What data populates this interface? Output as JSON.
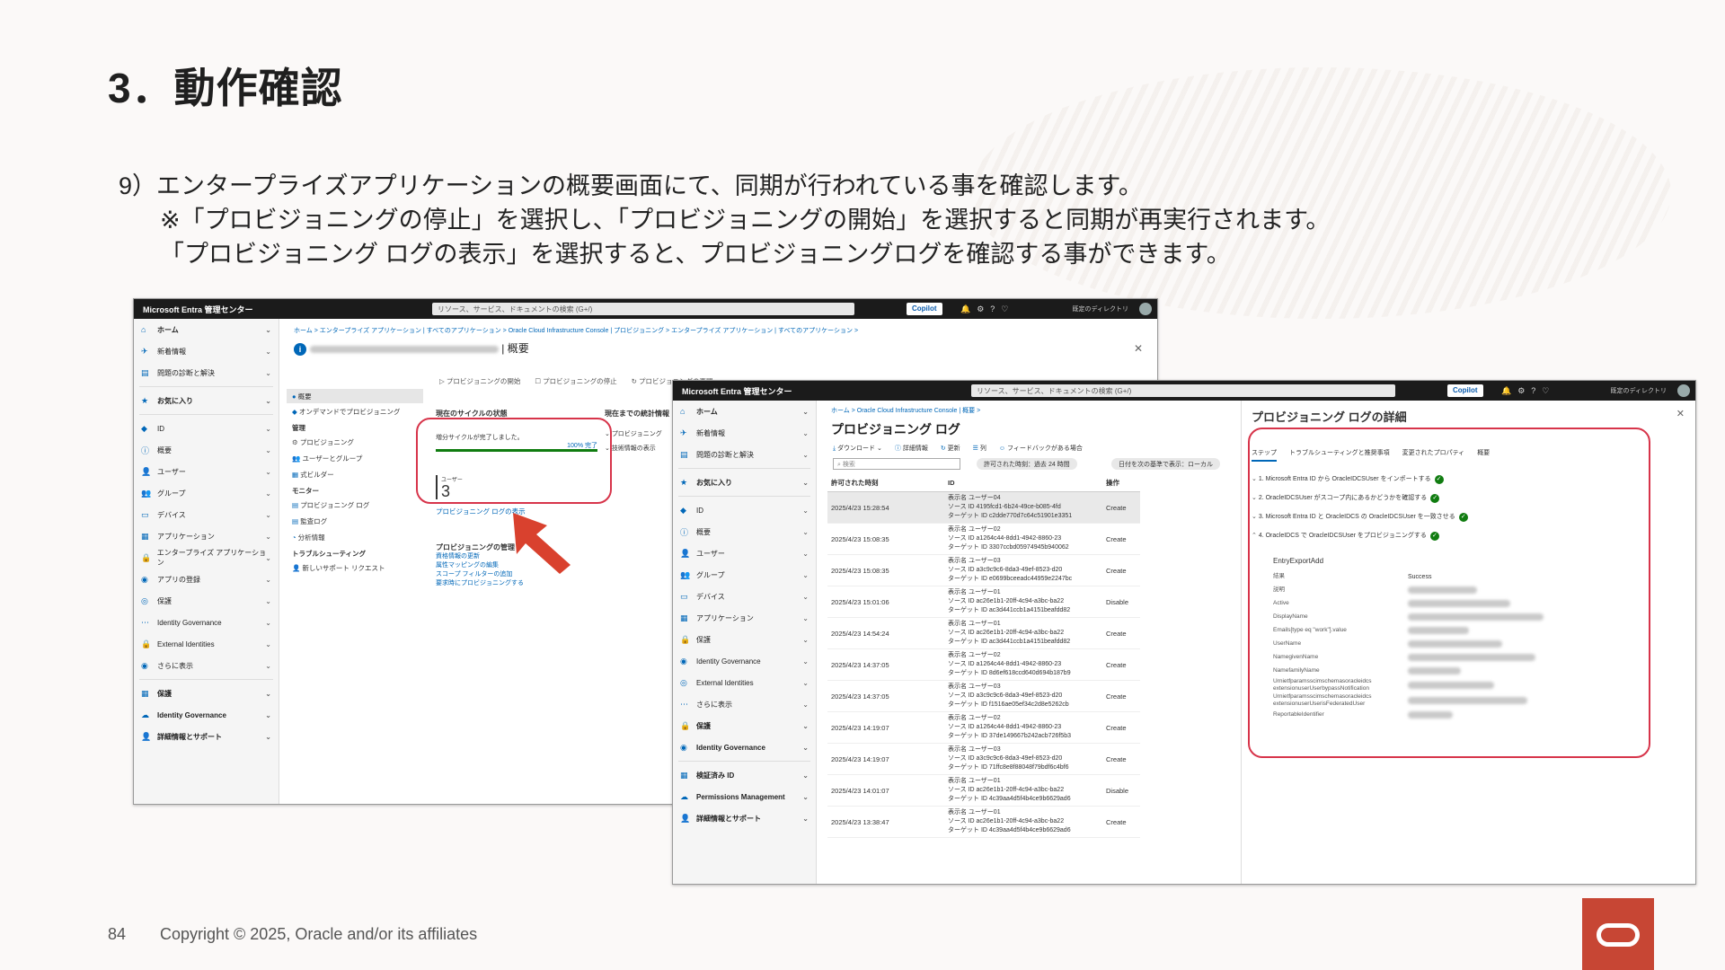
{
  "slide": {
    "title": "3．動作確認",
    "line1": "9）エンタープライズアプリケーションの概要画面にて、同期が行われている事を確認します。",
    "line2": "※「プロビジョニングの停止」を選択し、「プロビジョニングの開始」を選択すると同期が再実行されます。",
    "line3": "「プロビジョニング ログの表示」を選択すると、プロビジョニングログを確認する事ができます。",
    "page_number": "84",
    "copyright": "Copyright © 2025, Oracle and/or its affiliates"
  },
  "shot1": {
    "brand": "Microsoft Entra 管理センター",
    "search": "リソース、サービス、ドキュメントの検索 (G+/)",
    "copilot": "Copilot",
    "tenant": "既定のディレクトリ",
    "nav": [
      {
        "label": "ホーム",
        "bold": true
      },
      {
        "label": "新着情報"
      },
      {
        "label": "問題の診断と解決"
      },
      {
        "label": "お気に入り",
        "bold": true
      },
      {
        "label": "ID"
      },
      {
        "label": "概要"
      },
      {
        "label": "ユーザー"
      },
      {
        "label": "グループ"
      },
      {
        "label": "デバイス"
      },
      {
        "label": "アプリケーション"
      },
      {
        "label": "エンタープライズ アプリケーション"
      },
      {
        "label": "アプリの登録"
      },
      {
        "label": "保護"
      },
      {
        "label": "Identity Governance"
      },
      {
        "label": "External Identities"
      },
      {
        "label": "さらに表示"
      },
      {
        "label": "保護",
        "bold": true
      },
      {
        "label": "Identity Governance",
        "bold": true
      },
      {
        "label": "詳細情報とサポート",
        "bold": true
      }
    ],
    "breadcrumb": "ホーム > エンタープライズ アプリケーション | すべてのアプリケーション > Oracle Cloud Infrastructure Console | プロビジョニング > エンタープライズ アプリケーション | すべてのアプリケーション >",
    "page_suffix": "| 概要",
    "toolbar": [
      "プロビジョニングの開始",
      "プロビジョニングの停止",
      "プロビジョニングの再開"
    ],
    "left_menu": {
      "overview": "概要",
      "ondemand": "オンデマンドでプロビジョニング",
      "manage_head": "管理",
      "manage": [
        "プロビジョニング",
        "ユーザーとグループ",
        "式ビルダー"
      ],
      "monitor_head": "モニター",
      "monitor": [
        "プロビジョニング ログ",
        "監査ログ",
        "分析情報"
      ],
      "trouble_head": "トラブルシューティング",
      "trouble": [
        "新しいサポート リクエスト"
      ]
    },
    "cycle": {
      "heading": "現在のサイクルの状態",
      "status": "増分サイクルが完了しました。",
      "progress": 1.0,
      "progress_label": "100% 完了",
      "users_label": "ユーザー",
      "users_count": "3",
      "logs_link": "プロビジョニング ログの表示"
    },
    "stats": {
      "heading": "現在までの統計情報",
      "items": [
        "プロビジョニング",
        "技術情報の表示"
      ]
    },
    "manage_prov": {
      "heading": "プロビジョニングの管理",
      "links": [
        "資格情報の更新",
        "属性マッピングの編集",
        "スコープ フィルターの追加",
        "要求時にプロビジョニングする"
      ]
    }
  },
  "shot2": {
    "brand": "Microsoft Entra 管理センター",
    "search": "リソース、サービス、ドキュメントの検索 (G+/)",
    "copilot": "Copilot",
    "tenant": "既定のディレクトリ",
    "nav": [
      {
        "label": "ホーム",
        "bold": true
      },
      {
        "label": "新着情報"
      },
      {
        "label": "問題の診断と解決"
      },
      {
        "label": "お気に入り",
        "bold": true
      },
      {
        "label": "ID"
      },
      {
        "label": "概要"
      },
      {
        "label": "ユーザー"
      },
      {
        "label": "グループ"
      },
      {
        "label": "デバイス"
      },
      {
        "label": "アプリケーション"
      },
      {
        "label": "保護"
      },
      {
        "label": "Identity Governance"
      },
      {
        "label": "External Identities"
      },
      {
        "label": "さらに表示"
      },
      {
        "label": "保護",
        "bold": true
      },
      {
        "label": "Identity Governance",
        "bold": true
      },
      {
        "label": "検証済み ID",
        "bold": true
      },
      {
        "label": "Permissions Management",
        "bold": true
      },
      {
        "label": "詳細情報とサポート",
        "bold": true
      }
    ],
    "breadcrumb": "ホーム > Oracle Cloud Infrastructure Console | 概要 >",
    "page_title": "プロビジョニング ログ",
    "toolbar": [
      "ダウンロード",
      "詳細情報",
      "更新",
      "列",
      "フィードバックがある場合"
    ],
    "search_placeholder": "検索",
    "filter1": "許可された時刻：過去 24 時間",
    "filter2": "日付を次の基準で表示：ローカル",
    "columns": [
      "許可された時刻",
      "ID",
      "操作"
    ],
    "rows": [
      {
        "time": "2025/4/23 15:28:54",
        "name": "表示名 ユーザー04",
        "src": "ソース ID 4195fcd1-6b24-49ce-b085-4fd",
        "tgt": "ターゲット ID c2dde770d7c64c51901e3351",
        "op": "Create"
      },
      {
        "time": "2025/4/23 15:08:35",
        "name": "表示名 ユーザー02",
        "src": "ソース ID a1264c44-8dd1-4942-8860-23",
        "tgt": "ターゲット ID 3307ccbd05974945b940062",
        "op": "Create"
      },
      {
        "time": "2025/4/23 15:08:35",
        "name": "表示名 ユーザー03",
        "src": "ソース ID a3c9c9c6-8da3-49ef-8523-d20",
        "tgt": "ターゲット ID e0699bceeadc44959e2247bc",
        "op": "Create"
      },
      {
        "time": "2025/4/23 15:01:06",
        "name": "表示名 ユーザー01",
        "src": "ソース ID ac26e1b1-20ff-4c94-a3bc-ba22",
        "tgt": "ターゲット ID ac3d441ccb1a4151beafdd82",
        "op": "Disable"
      },
      {
        "time": "2025/4/23 14:54:24",
        "name": "表示名 ユーザー01",
        "src": "ソース ID ac26e1b1-20ff-4c94-a3bc-ba22",
        "tgt": "ターゲット ID ac3d441ccb1a4151beafdd82",
        "op": "Create"
      },
      {
        "time": "2025/4/23 14:37:05",
        "name": "表示名 ユーザー02",
        "src": "ソース ID a1264c44-8dd1-4942-8860-23",
        "tgt": "ターゲット ID 8d6ef618ccd640d694b187b9",
        "op": "Create"
      },
      {
        "time": "2025/4/23 14:37:05",
        "name": "表示名 ユーザー03",
        "src": "ソース ID a3c9c9c6-8da3-49ef-8523-d20",
        "tgt": "ターゲット ID f1516ae05ef34c2d8e5262cb",
        "op": "Create"
      },
      {
        "time": "2025/4/23 14:19:07",
        "name": "表示名 ユーザー02",
        "src": "ソース ID a1264c44-8dd1-4942-8860-23",
        "tgt": "ターゲット ID 37de149667b242acb726f5b3",
        "op": "Create"
      },
      {
        "time": "2025/4/23 14:19:07",
        "name": "表示名 ユーザー03",
        "src": "ソース ID a3c9c9c6-8da3-49ef-8523-d20",
        "tgt": "ターゲット ID 71ffc8e8f88048f79bdf6c4bf6",
        "op": "Create"
      },
      {
        "time": "2025/4/23 14:01:07",
        "name": "表示名 ユーザー01",
        "src": "ソース ID ac26e1b1-20ff-4c94-a3bc-ba22",
        "tgt": "ターゲット ID 4c39aa4d5f4b4ce9b6629ad6",
        "op": "Disable"
      },
      {
        "time": "2025/4/23 13:38:47",
        "name": "表示名 ユーザー01",
        "src": "ソース ID ac26e1b1-20ff-4c94-a3bc-ba22",
        "tgt": "ターゲット ID 4c39aa4d5f4b4ce9b6629ad6",
        "op": "Create"
      }
    ],
    "detail": {
      "title": "プロビジョニング ログの詳細",
      "tabs": [
        "ステップ",
        "トラブルシューティングと推奨事項",
        "変更されたプロパティ",
        "概要"
      ],
      "steps": [
        "1. Microsoft Entra ID から OracleIDCSUser をインポートする",
        "2. OracleIDCSUser がスコープ内にあるかどうかを確認する",
        "3. Microsoft Entra ID と OracleIDCS の OracleIDCSUser を一致させる",
        "4. OracleIDCS で OracleIDCSUser をプロビジョニングする"
      ],
      "export_heading": "EntryExportAdd",
      "props": [
        {
          "k": "結果",
          "v": "Success"
        },
        {
          "k": "説明"
        },
        {
          "k": "Active"
        },
        {
          "k": "DisplayName"
        },
        {
          "k": "Emails[type eq \"work\"].value"
        },
        {
          "k": "UserName"
        },
        {
          "k": "NamegivenName"
        },
        {
          "k": "NamefamilyName"
        },
        {
          "k": "Urnietfparamsscimschemasoracleidcs extensionuserUserbypassNotification"
        },
        {
          "k": "Urnietfparamsscimschemasoracleidcs extensionuserUserisFederatedUser"
        },
        {
          "k": "ReportableIdentifier"
        }
      ]
    }
  }
}
